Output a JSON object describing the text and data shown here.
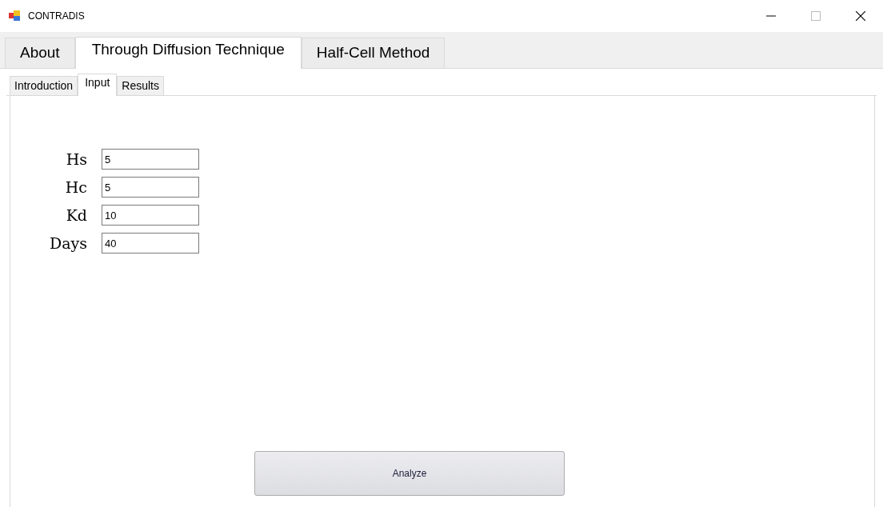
{
  "window": {
    "title": "CONTRADIS"
  },
  "tabs": [
    {
      "label": "About",
      "selected": false
    },
    {
      "label": "Through Diffusion Technique",
      "selected": true
    },
    {
      "label": "Half-Cell Method",
      "selected": false
    }
  ],
  "subtabs": [
    {
      "label": "Introduction",
      "selected": false
    },
    {
      "label": "Input",
      "selected": true
    },
    {
      "label": "Results",
      "selected": false
    }
  ],
  "fields": [
    {
      "label": "Hs",
      "value": "5"
    },
    {
      "label": "Hc",
      "value": "5"
    },
    {
      "label": "Kd",
      "value": "10"
    },
    {
      "label": "Days",
      "value": "40"
    }
  ],
  "button": "Analyze"
}
